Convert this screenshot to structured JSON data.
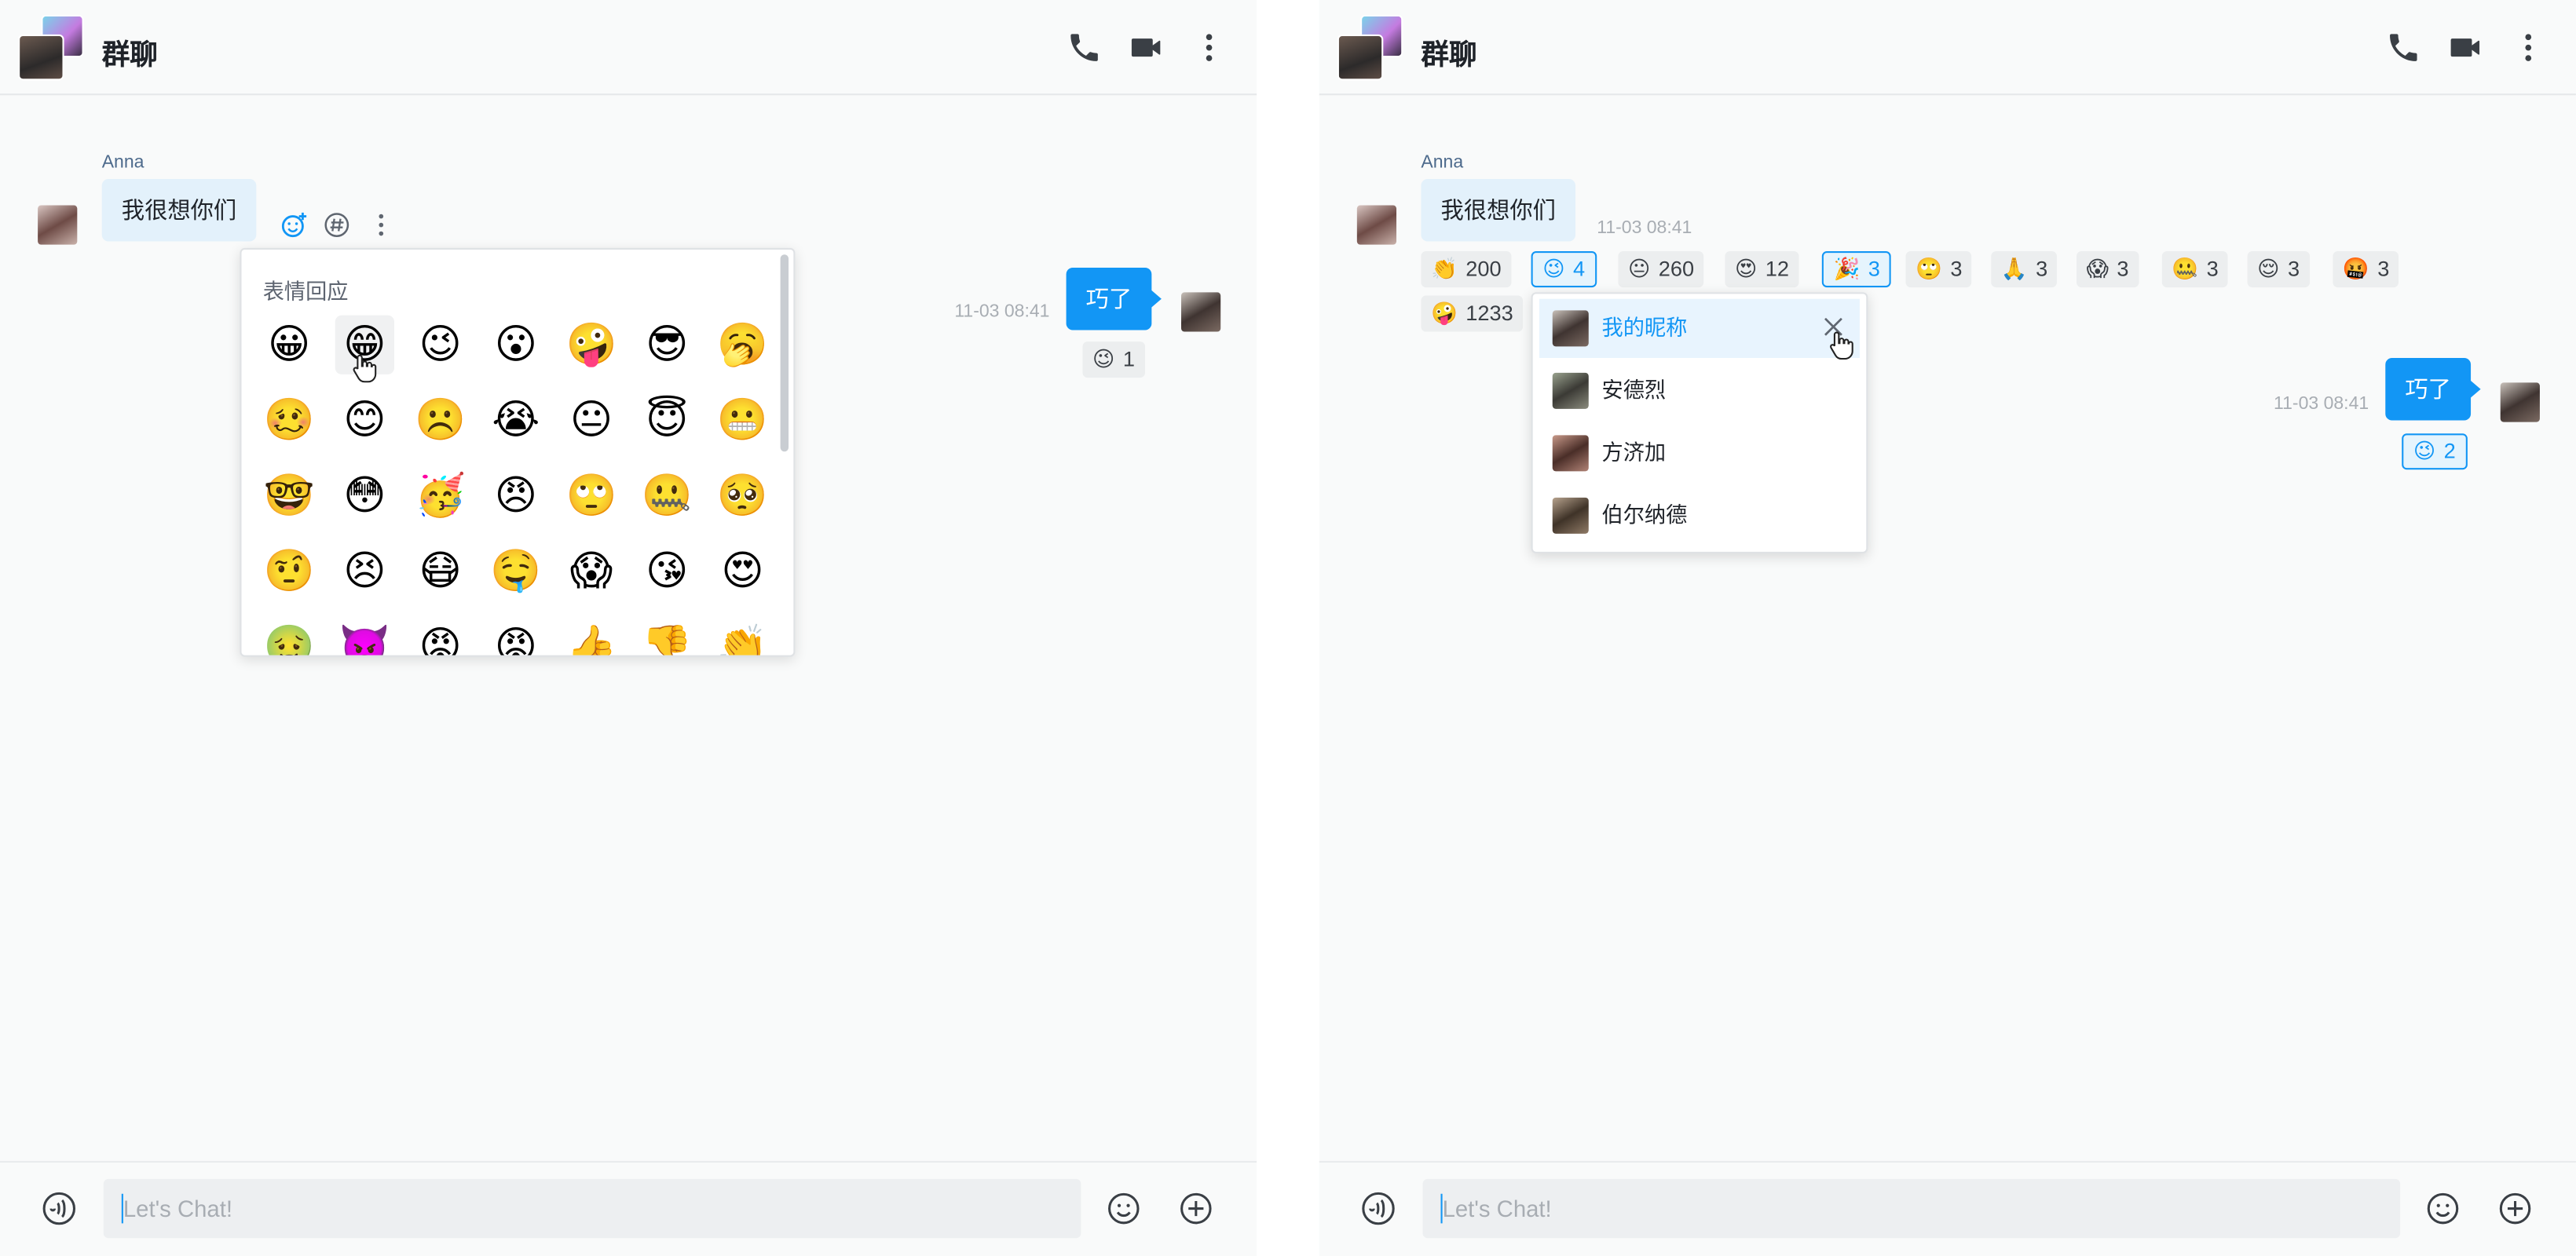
{
  "left": {
    "header": {
      "title": "群聊"
    },
    "message_in": {
      "sender": "Anna",
      "text": "我很想你们"
    },
    "message_out": {
      "text": "巧了",
      "time": "11-03 08:41"
    },
    "out_reactions": [
      {
        "emoji": "😉",
        "count": "1"
      }
    ],
    "emoji_panel": {
      "title": "表情回应",
      "rows": [
        [
          "😀",
          "😁",
          "😉",
          "😮",
          "🤪",
          "😎",
          "🥱"
        ],
        [
          "🥴",
          "😊",
          "☹️",
          "😭",
          "😐",
          "😇",
          "😬"
        ],
        [
          "🤓",
          "😳",
          "🥳",
          "😠",
          "🙄",
          "🤐",
          "🥺"
        ],
        [
          "🤨",
          "😣",
          "😷",
          "🤤",
          "😱",
          "😘",
          "😍"
        ],
        [
          "🤢",
          "👿",
          "😡",
          "😡",
          "👍",
          "👎",
          "👏"
        ]
      ]
    },
    "input": {
      "placeholder": "Let's Chat!"
    }
  },
  "right": {
    "header": {
      "title": "群聊"
    },
    "message_in": {
      "sender": "Anna",
      "text": "我很想你们",
      "time": "11-03 08:41"
    },
    "reactions": [
      {
        "emoji": "👏",
        "count": "200",
        "selected": false
      },
      {
        "emoji": "😉",
        "count": "4",
        "selected": true
      },
      {
        "emoji": "😐",
        "count": "260",
        "selected": false
      },
      {
        "emoji": "😍",
        "count": "12",
        "selected": false
      },
      {
        "emoji": "🎉",
        "count": "3",
        "selected": true
      },
      {
        "emoji": "🙄",
        "count": "3",
        "selected": false
      },
      {
        "emoji": "🙏",
        "count": "3",
        "selected": false
      },
      {
        "emoji": "😱",
        "count": "3",
        "selected": false
      },
      {
        "emoji": "🤐",
        "count": "3",
        "selected": false
      },
      {
        "emoji": "😌",
        "count": "3",
        "selected": false
      },
      {
        "emoji": "🤬",
        "count": "3",
        "selected": false
      },
      {
        "emoji": "🤪",
        "count": "1233",
        "selected": false
      }
    ],
    "user_popup": {
      "users": [
        "我的昵称",
        "安德烈",
        "方济加",
        "伯尔纳德"
      ]
    },
    "message_out": {
      "text": "巧了",
      "time": "11-03 08:41"
    },
    "out_reactions": [
      {
        "emoji": "😉",
        "count": "2"
      }
    ],
    "input": {
      "placeholder": "Let's Chat!"
    }
  },
  "colors": {
    "accent": "#1296f5",
    "incoming_bubble": "#e3f1fb",
    "outgoing_bubble": "#1296f5"
  }
}
